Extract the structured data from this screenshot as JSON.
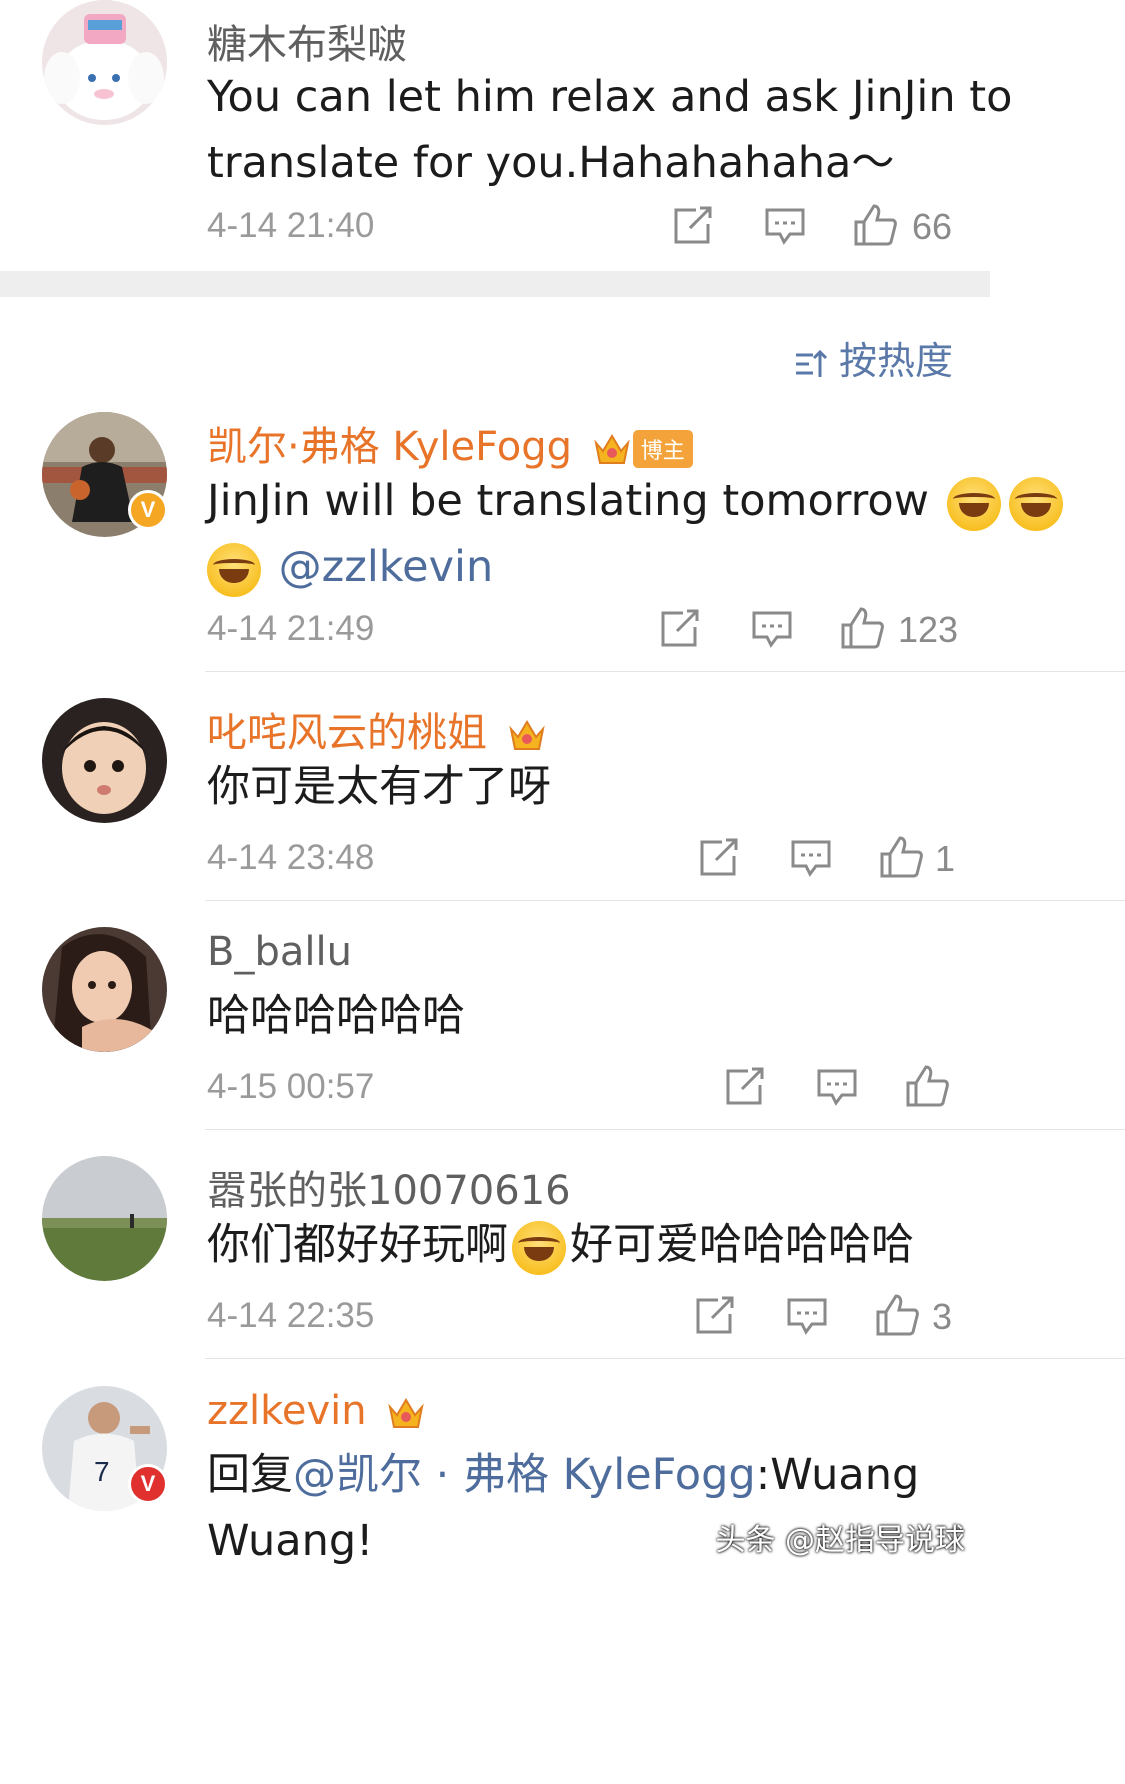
{
  "sort_label": "按热度",
  "comments": [
    {
      "username": "糖木布梨啵",
      "text": "You can let him relax and ask JinJin to translate for you.Hahahahaha～",
      "time": "4-14 21:40",
      "likes": "66",
      "avatar_icon": "cinnamoroll-avatar"
    },
    {
      "username": "凯尔·弗格 KyleFogg",
      "badge": "博主",
      "text": "JinJin will be translating tomorrow",
      "mention": "@zzlkevin",
      "time": "4-14 21:49",
      "likes": "123",
      "verified": "V"
    },
    {
      "username": "叱咤风云的桃姐",
      "text": "你可是太有才了呀",
      "time": "4-14 23:48",
      "likes": "1"
    },
    {
      "username": "B_ballu",
      "text": "哈哈哈哈哈哈",
      "time": "4-15 00:57",
      "likes": ""
    },
    {
      "username": "嚣张的张10070616",
      "text_before": "你们都好好玩啊",
      "text_after": "好可爱哈哈哈哈哈",
      "time": "4-14 22:35",
      "likes": "3"
    },
    {
      "username": "zzlkevin",
      "reply_prefix": "回复",
      "reply_mention": "@凯尔 · 弗格 KyleFogg",
      "text": ":Wuang Wuang!",
      "verified": "V"
    }
  ],
  "watermark": "头条 @赵指导说球",
  "colors": {
    "vip_name": "#e8742a",
    "link": "#4e6d9c",
    "badge": "#f5a623"
  }
}
